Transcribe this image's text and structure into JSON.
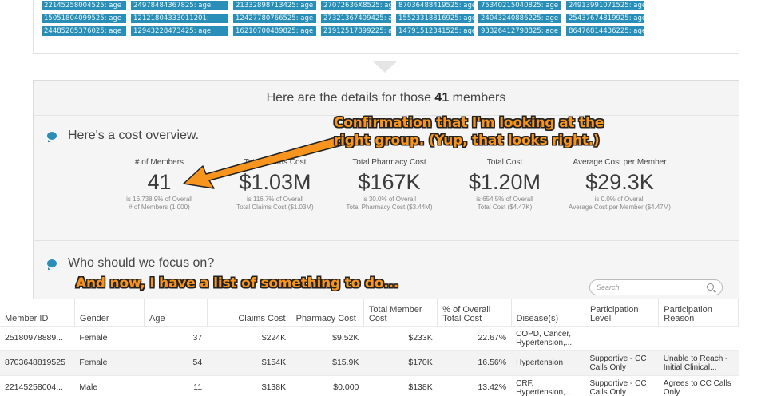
{
  "tag_rows": [
    [
      "22145258004525: age",
      "24978484367825: age",
      "21332898713425: age",
      "27072636X8525: age",
      "87036488419525: age",
      "75340215040825: age",
      "24913991071525: age"
    ],
    [
      "15051804099525: age",
      "12121804333011201:",
      "12427780766525: age",
      "27321367409425: age",
      "15523318816925: age",
      "24043240886225: age",
      "25437674819925: age"
    ],
    [
      "24485205376025: age",
      "12943228473425: age",
      "16210700489825: age",
      "21912517899225: age",
      "14791512341525: age",
      "93326412798825: age",
      "86476814436225: age"
    ]
  ],
  "details": {
    "prefix": "Here are the details for those",
    "count": "41",
    "suffix": "members"
  },
  "cost_overview": {
    "title": "Here's a cost overview.",
    "stats": [
      {
        "label": "# of Members",
        "value": "41",
        "note1": "is 16,738.9% of Overall",
        "note2": "# of Members (1,000)"
      },
      {
        "label": "Total Claims Cost",
        "value": "$1.03M",
        "note1": "is 116.7% of Overall",
        "note2": "Total Claims Cost ($1.03M)"
      },
      {
        "label": "Total Pharmacy Cost",
        "value": "$167K",
        "note1": "is 30.0% of Overall",
        "note2": "Total Pharmacy Cost ($3.44M)"
      },
      {
        "label": "Total Cost",
        "value": "$1.20M",
        "note1": "is 654.5% of Overall",
        "note2": "Total Cost ($4.47K)"
      },
      {
        "label": "Average Cost per Member",
        "value": "$29.3K",
        "note1": "is 0.0% of Overall",
        "note2": "Average Cost per Member ($4.47M)"
      }
    ]
  },
  "focus": {
    "title": "Who should we focus on?",
    "search_placeholder": "Search",
    "columns": [
      "Member ID",
      "Gender",
      "Age",
      "Claims Cost",
      "Pharmacy Cost",
      "Total Member Cost",
      "% of Overall Total Cost",
      "Disease(s)",
      "Participation Level",
      "Participation Reason"
    ],
    "rows": [
      [
        "25180978889...",
        "Female",
        "37",
        "$224K",
        "$9.52K",
        "$233K",
        "22.67%",
        "COPD, Cancer, Hypertension,...",
        "",
        ""
      ],
      [
        "8703648819525",
        "Female",
        "54",
        "$154K",
        "$15.9K",
        "$170K",
        "16.56%",
        "Hypertension",
        "Supportive - CC Calls Only",
        "Unable to Reach - Initial Clinical..."
      ],
      [
        "22145258004...",
        "Male",
        "11",
        "$138K",
        "$0.000",
        "$138K",
        "13.42%",
        "CRF, Hypertension,...",
        "Supportive - CC Calls Only",
        "Agrees to CC Calls Only"
      ]
    ]
  },
  "annotations": {
    "a1_line1": "Confirmation that I'm looking at the",
    "a1_line2": "right group. (Yup, that looks right.)",
    "a2": "And now, I have a list of something to do..."
  },
  "colors": {
    "accent": "#2a8fb8",
    "annotation": "#f7941d"
  }
}
